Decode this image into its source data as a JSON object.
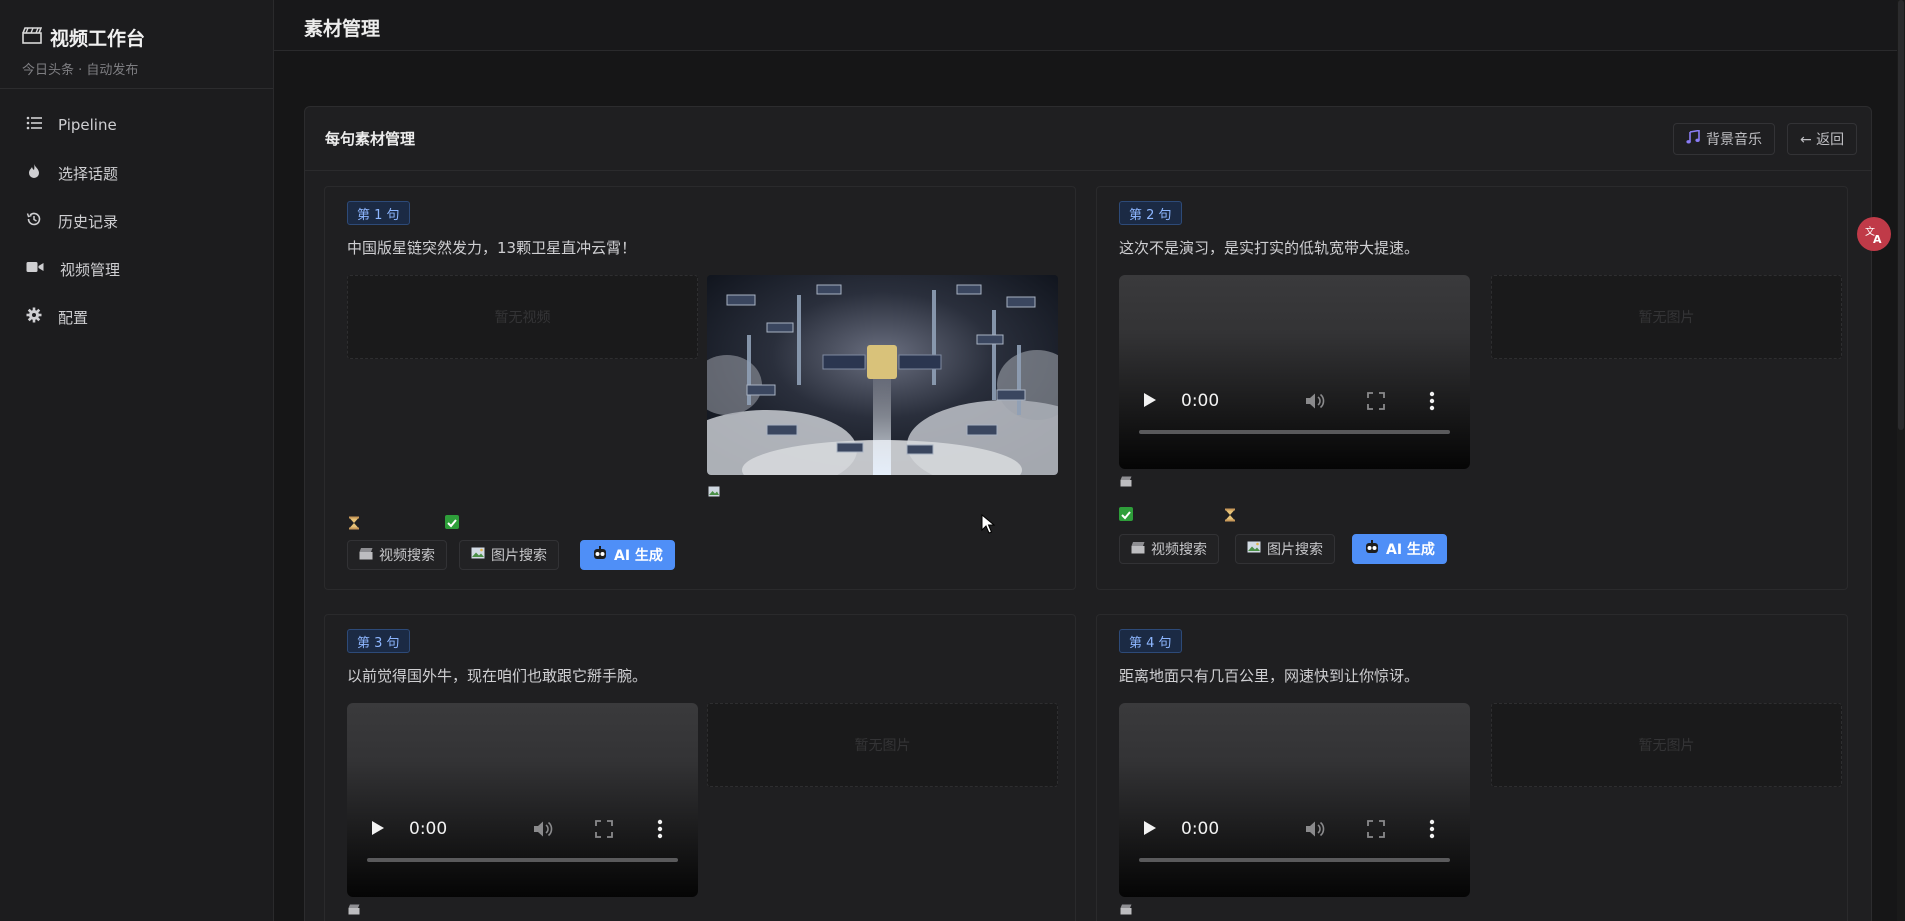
{
  "sidebar": {
    "brand_title": "视频工作台",
    "brand_sub": "今日头条 · 自动发布",
    "items": [
      {
        "label": "Pipeline",
        "icon": "list-icon"
      },
      {
        "label": "选择话题",
        "icon": "fire-icon"
      },
      {
        "label": "历史记录",
        "icon": "history-icon"
      },
      {
        "label": "视频管理",
        "icon": "video-camera-icon"
      },
      {
        "label": "配置",
        "icon": "gear-icon"
      }
    ]
  },
  "topbar": {
    "title": "素材管理"
  },
  "panel": {
    "title": "每句素材管理",
    "music_label": "背景音乐",
    "back_label": "← 返回"
  },
  "cards": [
    {
      "badge": "第 1 句",
      "sentence": "中国版星链突然发力，13颗卫星直冲云霄！",
      "placeholder": "暂无视频"
    },
    {
      "badge": "第 2 句",
      "sentence": "这次不是演习，是实打实的低轨宽带大提速。",
      "placeholder": "暂无图片"
    },
    {
      "badge": "第 3 句",
      "sentence": "以前觉得国外牛，现在咱们也敢跟它掰手腕。",
      "placeholder": "暂无图片"
    },
    {
      "badge": "第 4 句",
      "sentence": "距离地面只有几百公里，网速快到让你惊讶。",
      "placeholder": "暂无图片"
    }
  ],
  "actions": {
    "video_search": "视频搜索",
    "image_search": "图片搜索",
    "ai_generate": "AI 生成"
  },
  "video_player": {
    "time": "0:00"
  },
  "colors": {
    "accent": "#4f8ff7",
    "badge_text": "#8db6ff",
    "check": "#2e9e3a"
  }
}
